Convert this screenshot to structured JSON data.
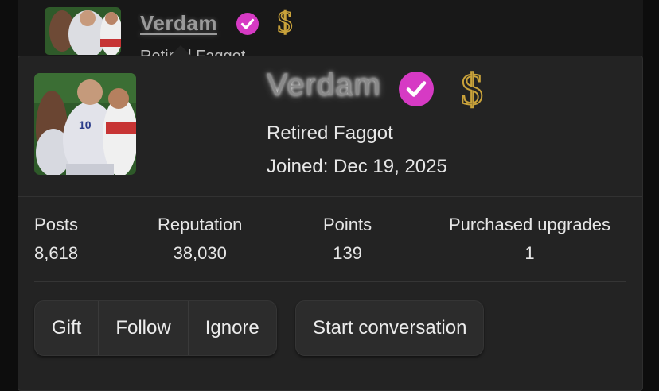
{
  "background_post": {
    "username": "Verdam",
    "user_title": "Retired Faggot"
  },
  "member_card": {
    "avatar_icon": "user-avatar-photo",
    "username": "Verdam",
    "verified_icon": "verified-badge-icon",
    "upgrade_icon": "dollar-sign-icon",
    "user_title": "Retired Faggot",
    "joined": "Joined: Dec 19, 2025",
    "stats": [
      {
        "label": "Posts",
        "value": "8,618"
      },
      {
        "label": "Reputation",
        "value": "38,030"
      },
      {
        "label": "Points",
        "value": "139"
      },
      {
        "label": "Purchased upgrades",
        "value": "1"
      }
    ],
    "actions": {
      "gift": "Gift",
      "follow": "Follow",
      "ignore": "Ignore",
      "start_conversation": "Start conversation"
    }
  },
  "colors": {
    "verified_badge": "#d63ac4",
    "dollar_gold": "#c9a23a",
    "card_background": "#232323",
    "button_background": "#2c2c2c"
  }
}
